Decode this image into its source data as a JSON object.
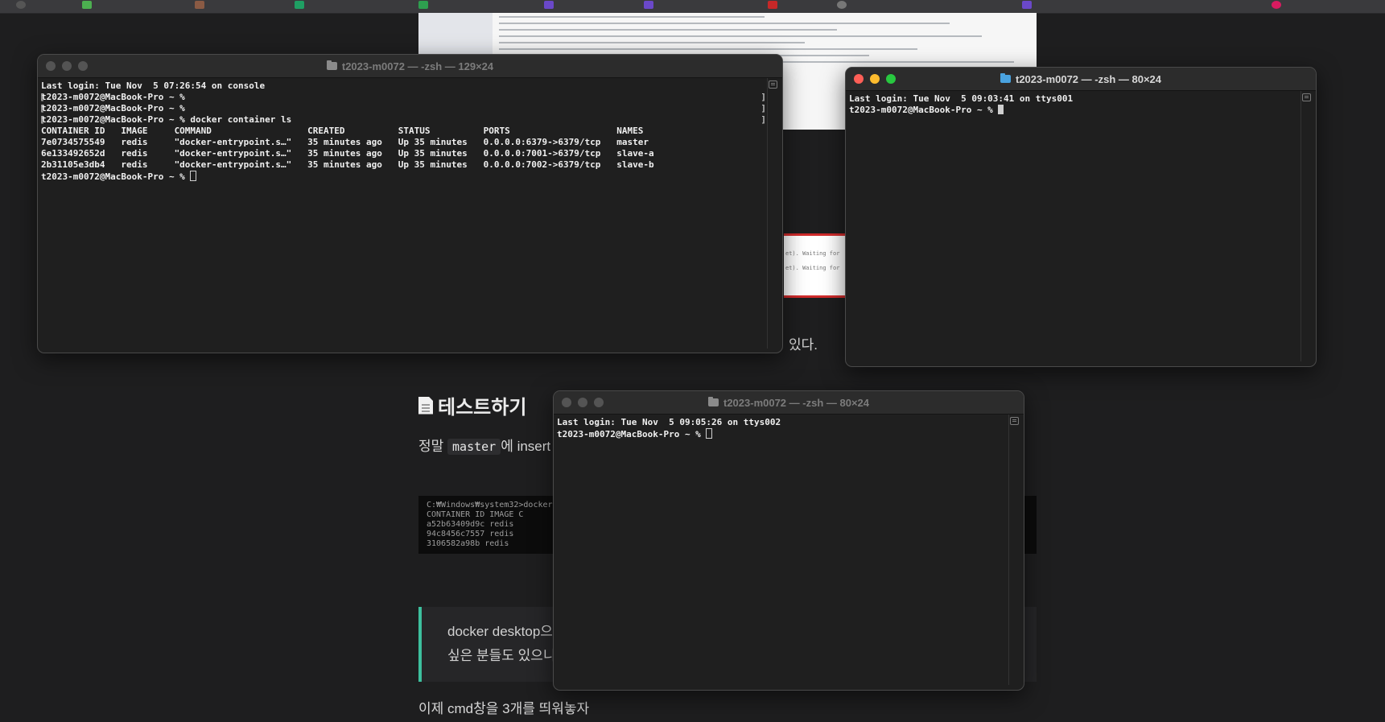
{
  "terminal1": {
    "title": "t2023-m0072 — -zsh — 129×24",
    "lines": [
      "Last login: Tue Nov  5 07:26:54 on console",
      "t2023-m0072@MacBook-Pro ~ %",
      "t2023-m0072@MacBook-Pro ~ %",
      "t2023-m0072@MacBook-Pro ~ % docker container ls",
      "CONTAINER ID   IMAGE     COMMAND                  CREATED          STATUS          PORTS                    NAMES",
      "7e0734575549   redis     \"docker-entrypoint.s…\"   35 minutes ago   Up 35 minutes   0.0.0.0:6379->6379/tcp   master",
      "6e133492652d   redis     \"docker-entrypoint.s…\"   35 minutes ago   Up 35 minutes   0.0.0.0:7001->6379/tcp   slave-a",
      "2b31105e3db4   redis     \"docker-entrypoint.s…\"   35 minutes ago   Up 35 minutes   0.0.0.0:7002->6379/tcp   slave-b"
    ],
    "prompt": "t2023-m0072@MacBook-Pro ~ % "
  },
  "terminal2": {
    "title": "t2023-m0072 — -zsh — 80×24",
    "lines": [
      "Last login: Tue Nov  5 09:03:41 on ttys001"
    ],
    "prompt": "t2023-m0072@MacBook-Pro ~ % "
  },
  "terminal3": {
    "title": "t2023-m0072 — -zsh — 80×24",
    "lines": [
      "Last login: Tue Nov  5 09:05:26 on ttys002"
    ],
    "prompt": "t2023-m0072@MacBook-Pro ~ % "
  },
  "blog": {
    "fragment_right": "있다.",
    "heading": "테스트하기",
    "para_prefix": "정말",
    "para_code": "master",
    "para_suffix": "에 insert",
    "cmd_lines": [
      "C:₩Windows₩system32>docker",
      "CONTAINER ID   IMAGE     C",
      "a52b63409d9c   redis     ",
      "94c8456c7557   redis     ",
      "3106582a98b    redis     "
    ],
    "quote_line1": "docker desktop으",
    "quote_line2": "싶은 분들도 있으니",
    "bottom_text": "이제 cmd창을 3개를 띄워놓자"
  },
  "colors": {
    "terminal_bg": "#1f1f1f",
    "page_bg": "#1e1e1f",
    "quote_accent": "#3dbf9d"
  }
}
